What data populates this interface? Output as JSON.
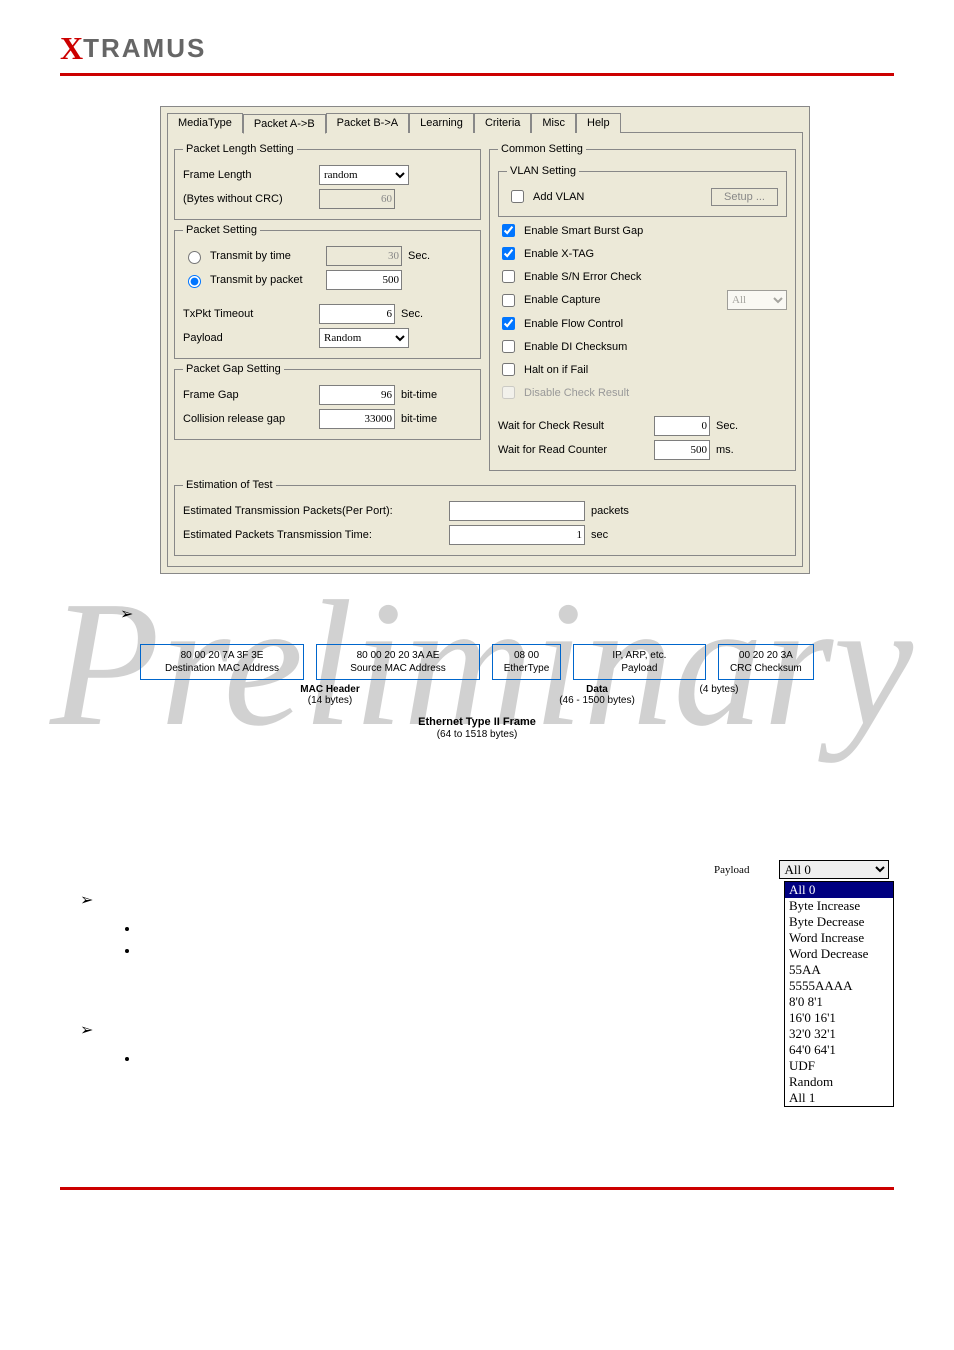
{
  "logo": {
    "x": "X",
    "rest": "TRAMUS"
  },
  "tabs": [
    "MediaType",
    "Packet A->B",
    "Packet B->A",
    "Learning",
    "Criteria",
    "Misc",
    "Help"
  ],
  "pls": {
    "legend": "Packet Length Setting",
    "frame_length_label": "Frame Length",
    "frame_length_value": "random",
    "bytes_label": "(Bytes without CRC)",
    "bytes_value": "60"
  },
  "ps": {
    "legend": "Packet Setting",
    "transmit_time_label": "Transmit by time",
    "transmit_time_value": "30",
    "sec": "Sec.",
    "transmit_packet_label": "Transmit by packet",
    "transmit_packet_value": "500",
    "txpkt_label": "TxPkt Timeout",
    "txpkt_value": "6",
    "payload_label": "Payload",
    "payload_value": "Random"
  },
  "pgs": {
    "legend": "Packet Gap Setting",
    "frame_gap_label": "Frame Gap",
    "frame_gap_value": "96",
    "bt": "bit-time",
    "collision_label": "Collision release gap",
    "collision_value": "33000"
  },
  "cs": {
    "legend": "Common Setting",
    "vlan_legend": "VLAN Setting",
    "add_vlan": "Add VLAN",
    "setup": "Setup ...",
    "c1": "Enable Smart Burst Gap",
    "c2": "Enable X-TAG",
    "c3": "Enable S/N Error Check",
    "c4": "Enable Capture",
    "c4v": "All",
    "c5": "Enable Flow Control",
    "c6": "Enable DI Checksum",
    "c7": "Halt on if Fail",
    "c8": "Disable Check Result",
    "wait_check": "Wait for Check Result",
    "wait_check_v": "0",
    "wait_read": "Wait for Read Counter",
    "wait_read_v": "500",
    "ms": "ms."
  },
  "est": {
    "legend": "Estimation of Test",
    "l1": "Estimated Transmission Packets(Per Port):",
    "l1u": "packets",
    "l2": "Estimated Packets Transmission Time:",
    "l2v": "1",
    "l2u": "sec"
  },
  "diagram": {
    "b1a": "80  00  20  7A  3F  3E",
    "b1b": "Destination MAC Address",
    "b2a": "80  00  20  20  3A  AE",
    "b2b": "Source MAC Address",
    "b3a": "08  00",
    "b3b": "EtherType",
    "b4a": "IP, ARP, etc.",
    "b4b": "Payload",
    "b5a": "00  20  20  3A",
    "b5b": "CRC Checksum",
    "mac_header": "MAC Header",
    "mac_bytes": "(14 bytes)",
    "data": "Data",
    "data_bytes": "(46 - 1500 bytes)",
    "crc_bytes": "(4 bytes)",
    "frame_title": "Ethernet Type II Frame",
    "frame_bytes": "(64 to 1518 bytes)"
  },
  "payload_dd": {
    "label": "Payload",
    "value": "All 0",
    "options": [
      "All 0",
      "Byte Increase",
      "Byte Decrease",
      "Word Increase",
      "Word Decrease",
      "55AA",
      "5555AAAA",
      "8'0 8'1",
      "16'0 16'1",
      "32'0 32'1",
      "64'0 64'1",
      "UDF",
      "Random",
      "All 1"
    ]
  },
  "watermark": "Preliminary"
}
